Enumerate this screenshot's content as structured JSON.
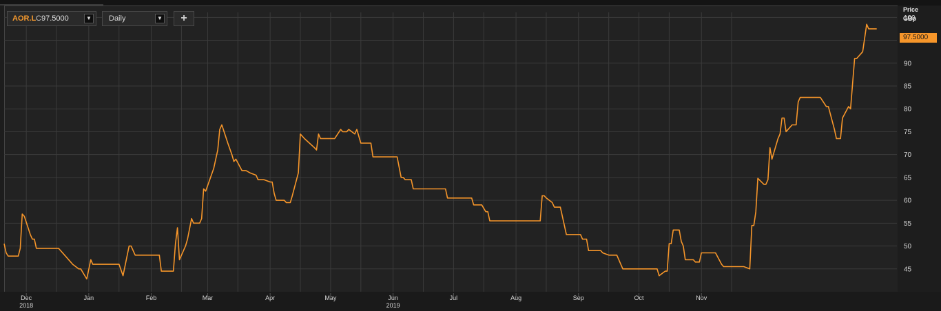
{
  "toolbar": {
    "symbol": "AOR.L",
    "close_prefix": "C",
    "close_value": "97.5000",
    "interval": "Daily",
    "add_label": "+",
    "dropdown_glyph": "▼"
  },
  "axis_title": [
    "Price",
    "GBp"
  ],
  "last_price_label": "97.5000",
  "colors": {
    "line": "#f7962a",
    "grid": "#3b3b3b",
    "background": "#222222"
  },
  "chart_data": {
    "type": "line",
    "title": "",
    "xlabel": "",
    "ylabel": "Price GBp",
    "ylim": [
      40,
      100.5
    ],
    "yticks": [
      45,
      50,
      55,
      60,
      65,
      70,
      75,
      80,
      85,
      90,
      95,
      100
    ],
    "grid": true,
    "xticks": [
      {
        "label": "Dec",
        "year": "2018",
        "date": "2018-12-01"
      },
      {
        "label": "Jan",
        "date": "2019-01-01"
      },
      {
        "label": "Feb",
        "date": "2019-02-01"
      },
      {
        "label": "Mar",
        "date": "2019-03-01"
      },
      {
        "label": "Apr",
        "date": "2019-04-01"
      },
      {
        "label": "May",
        "date": "2019-05-01"
      },
      {
        "label": "Jun",
        "year": "2019",
        "date": "2019-06-01"
      },
      {
        "label": "Jul",
        "date": "2019-07-01"
      },
      {
        "label": "Aug",
        "date": "2019-08-01"
      },
      {
        "label": "Sep",
        "date": "2019-09-01"
      },
      {
        "label": "Oct",
        "date": "2019-10-01"
      },
      {
        "label": "Nov",
        "date": "2019-11-01"
      }
    ],
    "series": [
      {
        "name": "AOR.L",
        "points": [
          [
            "2018-11-20",
            50.5
          ],
          [
            "2018-11-21",
            48.5
          ],
          [
            "2018-11-22",
            47.8
          ],
          [
            "2018-11-23",
            47.8
          ],
          [
            "2018-11-26",
            47.8
          ],
          [
            "2018-11-27",
            47.8
          ],
          [
            "2018-11-28",
            49.5
          ],
          [
            "2018-11-29",
            57.0
          ],
          [
            "2018-11-30",
            56.5
          ],
          [
            "2018-12-03",
            52.5
          ],
          [
            "2018-12-04",
            51.5
          ],
          [
            "2018-12-05",
            51.5
          ],
          [
            "2018-12-06",
            49.5
          ],
          [
            "2018-12-10",
            49.5
          ],
          [
            "2018-12-17",
            49.5
          ],
          [
            "2018-12-20",
            48.0
          ],
          [
            "2018-12-24",
            46.0
          ],
          [
            "2018-12-27",
            45.0
          ],
          [
            "2018-12-28",
            45.0
          ],
          [
            "2018-12-31",
            42.8
          ],
          [
            "2019-01-02",
            47.0
          ],
          [
            "2019-01-03",
            46.0
          ],
          [
            "2019-01-08",
            46.0
          ],
          [
            "2019-01-16",
            46.0
          ],
          [
            "2019-01-18",
            43.5
          ],
          [
            "2019-01-21",
            50.0
          ],
          [
            "2019-01-22",
            50.0
          ],
          [
            "2019-01-24",
            48.0
          ],
          [
            "2019-01-25",
            48.0
          ],
          [
            "2019-01-31",
            48.0
          ],
          [
            "2019-02-05",
            48.0
          ],
          [
            "2019-02-06",
            44.5
          ],
          [
            "2019-02-07",
            44.5
          ],
          [
            "2019-02-12",
            44.5
          ],
          [
            "2019-02-13",
            50.5
          ],
          [
            "2019-02-14",
            54.0
          ],
          [
            "2019-02-15",
            47.0
          ],
          [
            "2019-02-18",
            50.0
          ],
          [
            "2019-02-19",
            51.5
          ],
          [
            "2019-02-21",
            56.0
          ],
          [
            "2019-02-22",
            55.0
          ],
          [
            "2019-02-25",
            55.0
          ],
          [
            "2019-02-26",
            56.0
          ],
          [
            "2019-02-27",
            62.5
          ],
          [
            "2019-02-28",
            62.0
          ],
          [
            "2019-03-04",
            67.0
          ],
          [
            "2019-03-06",
            71.0
          ],
          [
            "2019-03-07",
            75.5
          ],
          [
            "2019-03-08",
            76.5
          ],
          [
            "2019-03-11",
            72.5
          ],
          [
            "2019-03-13",
            70.0
          ],
          [
            "2019-03-14",
            68.5
          ],
          [
            "2019-03-15",
            69.0
          ],
          [
            "2019-03-18",
            66.5
          ],
          [
            "2019-03-20",
            66.5
          ],
          [
            "2019-03-22",
            66.0
          ],
          [
            "2019-03-25",
            65.5
          ],
          [
            "2019-03-26",
            64.5
          ],
          [
            "2019-03-29",
            64.5
          ],
          [
            "2019-04-01",
            64.0
          ],
          [
            "2019-04-02",
            64.0
          ],
          [
            "2019-04-03",
            61.5
          ],
          [
            "2019-04-04",
            60.0
          ],
          [
            "2019-04-08",
            60.0
          ],
          [
            "2019-04-09",
            59.5
          ],
          [
            "2019-04-11",
            59.5
          ],
          [
            "2019-04-12",
            61.0
          ],
          [
            "2019-04-15",
            66.0
          ],
          [
            "2019-04-16",
            74.5
          ],
          [
            "2019-04-18",
            73.5
          ],
          [
            "2019-04-23",
            71.5
          ],
          [
            "2019-04-24",
            71.0
          ],
          [
            "2019-04-25",
            74.5
          ],
          [
            "2019-04-26",
            73.5
          ],
          [
            "2019-05-01",
            73.5
          ],
          [
            "2019-05-03",
            73.5
          ],
          [
            "2019-05-06",
            75.5
          ],
          [
            "2019-05-07",
            75.0
          ],
          [
            "2019-05-09",
            75.0
          ],
          [
            "2019-05-10",
            75.5
          ],
          [
            "2019-05-13",
            74.5
          ],
          [
            "2019-05-14",
            75.5
          ],
          [
            "2019-05-16",
            72.5
          ],
          [
            "2019-05-21",
            72.5
          ],
          [
            "2019-05-22",
            69.5
          ],
          [
            "2019-05-31",
            69.5
          ],
          [
            "2019-06-03",
            69.5
          ],
          [
            "2019-06-05",
            65.0
          ],
          [
            "2019-06-06",
            65.0
          ],
          [
            "2019-06-07",
            64.5
          ],
          [
            "2019-06-10",
            64.5
          ],
          [
            "2019-06-11",
            62.5
          ],
          [
            "2019-06-17",
            62.5
          ],
          [
            "2019-06-24",
            62.5
          ],
          [
            "2019-06-27",
            62.5
          ],
          [
            "2019-06-28",
            60.5
          ],
          [
            "2019-07-05",
            60.5
          ],
          [
            "2019-07-10",
            60.5
          ],
          [
            "2019-07-11",
            59.0
          ],
          [
            "2019-07-15",
            59.0
          ],
          [
            "2019-07-17",
            57.5
          ],
          [
            "2019-07-18",
            57.5
          ],
          [
            "2019-07-19",
            55.5
          ],
          [
            "2019-07-26",
            55.5
          ],
          [
            "2019-08-02",
            55.5
          ],
          [
            "2019-08-09",
            55.5
          ],
          [
            "2019-08-13",
            55.5
          ],
          [
            "2019-08-14",
            61.0
          ],
          [
            "2019-08-15",
            61.0
          ],
          [
            "2019-08-16",
            60.5
          ],
          [
            "2019-08-19",
            59.5
          ],
          [
            "2019-08-20",
            58.5
          ],
          [
            "2019-08-23",
            58.5
          ],
          [
            "2019-08-26",
            52.5
          ],
          [
            "2019-08-30",
            52.5
          ],
          [
            "2019-09-02",
            52.5
          ],
          [
            "2019-09-03",
            51.5
          ],
          [
            "2019-09-05",
            51.5
          ],
          [
            "2019-09-06",
            49.0
          ],
          [
            "2019-09-12",
            49.0
          ],
          [
            "2019-09-13",
            48.5
          ],
          [
            "2019-09-16",
            48.0
          ],
          [
            "2019-09-20",
            48.0
          ],
          [
            "2019-09-23",
            45.0
          ],
          [
            "2019-09-30",
            45.0
          ],
          [
            "2019-10-07",
            45.0
          ],
          [
            "2019-10-10",
            45.0
          ],
          [
            "2019-10-11",
            43.5
          ],
          [
            "2019-10-14",
            44.5
          ],
          [
            "2019-10-15",
            44.5
          ],
          [
            "2019-10-16",
            50.5
          ],
          [
            "2019-10-17",
            50.5
          ],
          [
            "2019-10-18",
            53.5
          ],
          [
            "2019-10-21",
            53.5
          ],
          [
            "2019-10-22",
            51.0
          ],
          [
            "2019-10-23",
            50.0
          ],
          [
            "2019-10-24",
            47.0
          ],
          [
            "2019-10-28",
            47.0
          ],
          [
            "2019-10-29",
            46.5
          ],
          [
            "2019-10-31",
            46.5
          ],
          [
            "2019-11-01",
            48.5
          ],
          [
            "2019-11-04",
            48.5
          ],
          [
            "2019-11-08",
            48.5
          ],
          [
            "2019-11-11",
            46.0
          ],
          [
            "2019-11-12",
            45.5
          ],
          [
            "2019-11-18",
            45.5
          ],
          [
            "2019-11-22",
            45.5
          ],
          [
            "2019-11-25",
            45.0
          ],
          [
            "2019-11-26",
            54.5
          ],
          [
            "2019-11-27",
            54.5
          ],
          [
            "2019-11-28",
            57.5
          ],
          [
            "2019-11-29",
            64.8
          ],
          [
            "2019-12-02",
            63.5
          ],
          [
            "2019-12-03",
            63.5
          ],
          [
            "2019-12-04",
            64.5
          ],
          [
            "2019-12-05",
            71.5
          ],
          [
            "2019-12-06",
            69.0
          ],
          [
            "2019-12-09",
            73.5
          ],
          [
            "2019-12-10",
            74.5
          ],
          [
            "2019-12-11",
            78.0
          ],
          [
            "2019-12-12",
            78.0
          ],
          [
            "2019-12-13",
            75.0
          ],
          [
            "2019-12-16",
            76.5
          ],
          [
            "2019-12-18",
            76.5
          ],
          [
            "2019-12-19",
            81.5
          ],
          [
            "2019-12-20",
            82.5
          ],
          [
            "2019-12-23",
            82.5
          ],
          [
            "2019-12-30",
            82.5
          ],
          [
            "2020-01-02",
            80.5
          ],
          [
            "2020-01-03",
            80.5
          ],
          [
            "2020-01-06",
            75.5
          ],
          [
            "2020-01-07",
            73.5
          ],
          [
            "2020-01-09",
            73.5
          ],
          [
            "2020-01-10",
            78.0
          ],
          [
            "2020-01-13",
            80.5
          ],
          [
            "2020-01-14",
            80.0
          ],
          [
            "2020-01-16",
            91.0
          ],
          [
            "2020-01-17",
            91.0
          ],
          [
            "2020-01-20",
            92.5
          ],
          [
            "2020-01-22",
            98.5
          ],
          [
            "2020-01-23",
            97.5
          ],
          [
            "2020-01-27",
            97.5
          ]
        ]
      }
    ]
  }
}
